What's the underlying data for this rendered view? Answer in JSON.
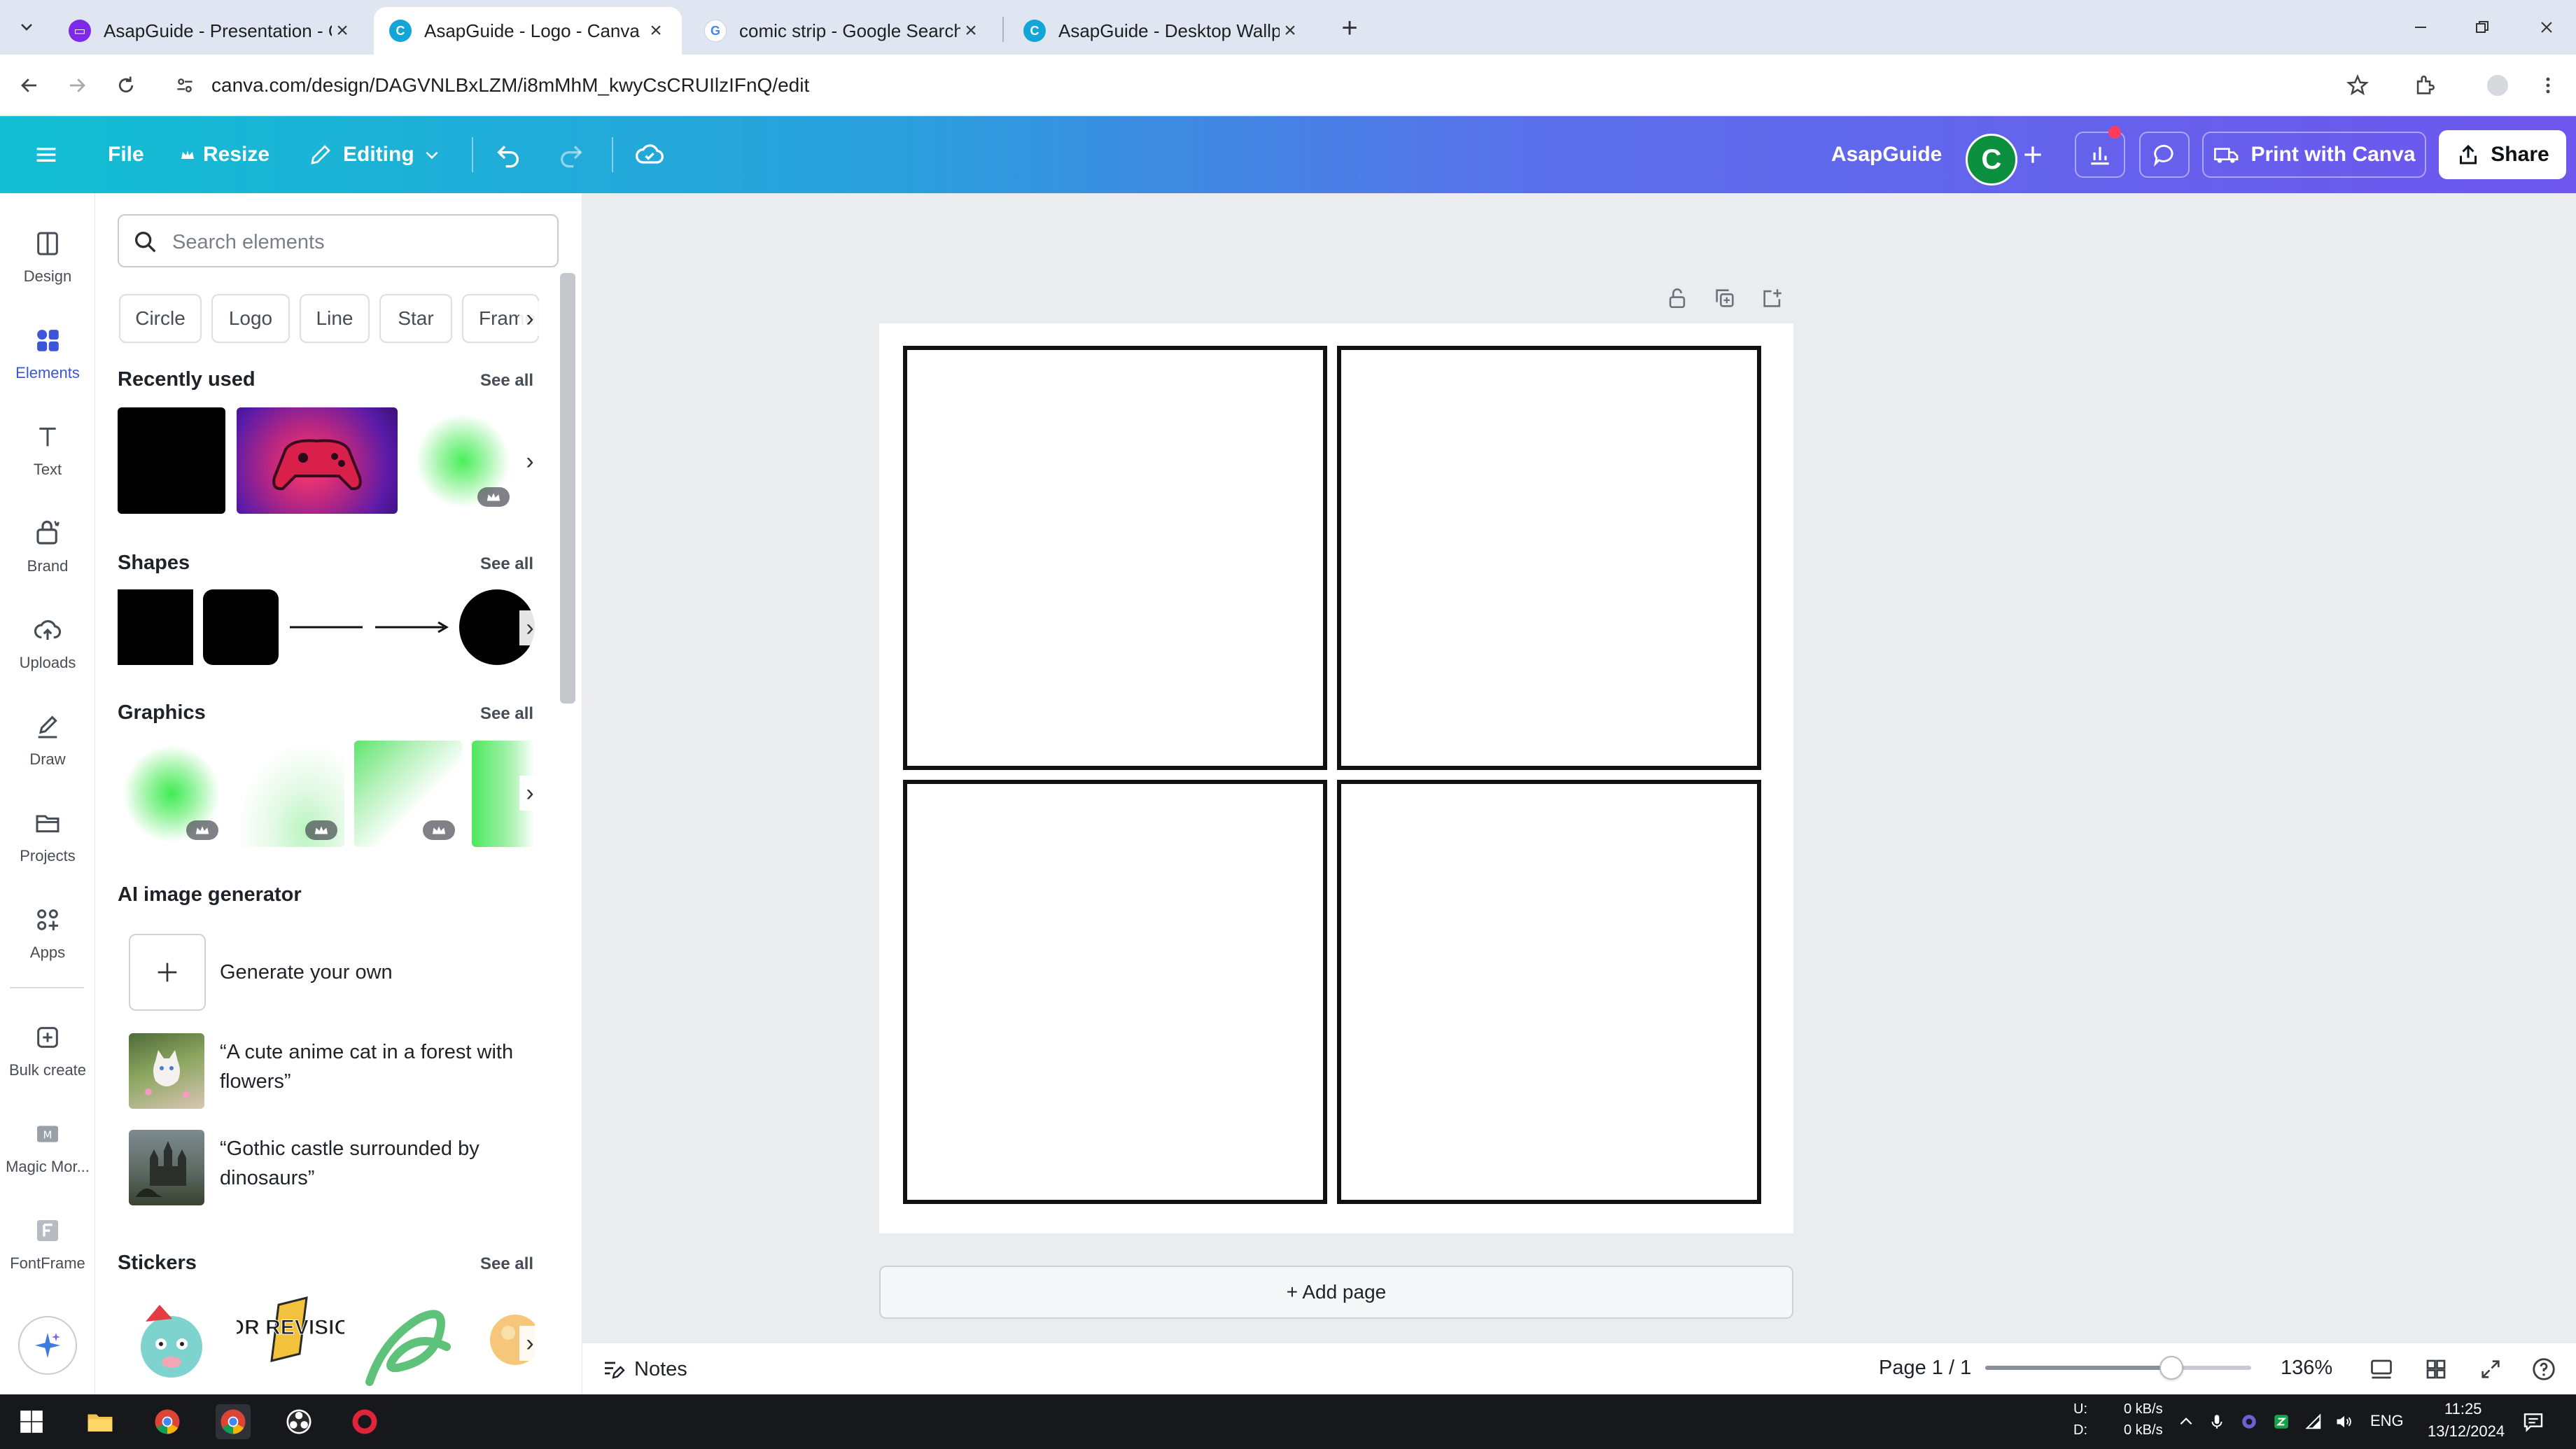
{
  "browser": {
    "tabs": [
      {
        "title": "AsapGuide - Presentation - Canva",
        "favicon": "canva-presentation-icon",
        "active": false
      },
      {
        "title": "AsapGuide - Logo - Canva",
        "favicon": "canva-icon",
        "active": true
      },
      {
        "title": "comic strip - Google Search",
        "favicon": "google-icon",
        "active": false
      },
      {
        "title": "AsapGuide - Desktop Wallpaper - Canva",
        "favicon": "canva-icon",
        "active": false
      }
    ],
    "new_tab_label": "+",
    "url": "canva.com/design/DAGVNLBxLZM/i8mMhM_kwyCsCRUIlzIFnQ/edit"
  },
  "header": {
    "file_label": "File",
    "resize_label": "Resize",
    "editing_label": "Editing",
    "brand_name": "AsapGuide",
    "avatar_letter": "C",
    "print_label": "Print with Canva",
    "share_label": "Share"
  },
  "rail": {
    "items": [
      {
        "label": "Design",
        "icon": "design-icon"
      },
      {
        "label": "Elements",
        "icon": "elements-icon",
        "active": true
      },
      {
        "label": "Text",
        "icon": "text-icon"
      },
      {
        "label": "Brand",
        "icon": "brand-icon"
      },
      {
        "label": "Uploads",
        "icon": "upload-icon"
      },
      {
        "label": "Draw",
        "icon": "draw-icon"
      },
      {
        "label": "Projects",
        "icon": "folder-icon"
      },
      {
        "label": "Apps",
        "icon": "apps-icon"
      },
      {
        "label": "Bulk create",
        "icon": "bulk-create-icon"
      },
      {
        "label": "Magic Mor...",
        "icon": "magic-morph-icon"
      },
      {
        "label": "FontFrame",
        "icon": "fontframe-icon"
      }
    ]
  },
  "panel": {
    "search_placeholder": "Search elements",
    "chips": [
      "Circle",
      "Logo",
      "Line",
      "Star",
      "Frame"
    ],
    "see_all": "See all",
    "recently_used_title": "Recently used",
    "shapes_title": "Shapes",
    "graphics_title": "Graphics",
    "ai_title": "AI image generator",
    "ai_generate_label": "Generate your own",
    "ai_prompts": [
      "“A cute anime cat in a forest with flowers”",
      "“Gothic castle surrounded by dinosaurs”"
    ],
    "stickers_title": "Stickers",
    "sticker_text": "FOR REVISION"
  },
  "canvas": {
    "add_page_label": "+ Add page"
  },
  "footer": {
    "notes_label": "Notes",
    "page_label": "Page 1 / 1",
    "zoom_label": "136%",
    "zoom_fraction": 0.7
  },
  "taskbar": {
    "net_up_label": "U:",
    "net_down_label": "D:",
    "net_up": "0 kB/s",
    "net_down": "0 kB/s",
    "language": "ENG",
    "time": "11:25",
    "date": "13/12/2024"
  },
  "colors": {
    "accent": "#3c55d9",
    "header_gradient_start": "#12bfd3",
    "header_gradient_end": "#6e56ee",
    "avatar": "#0c8f3e"
  }
}
